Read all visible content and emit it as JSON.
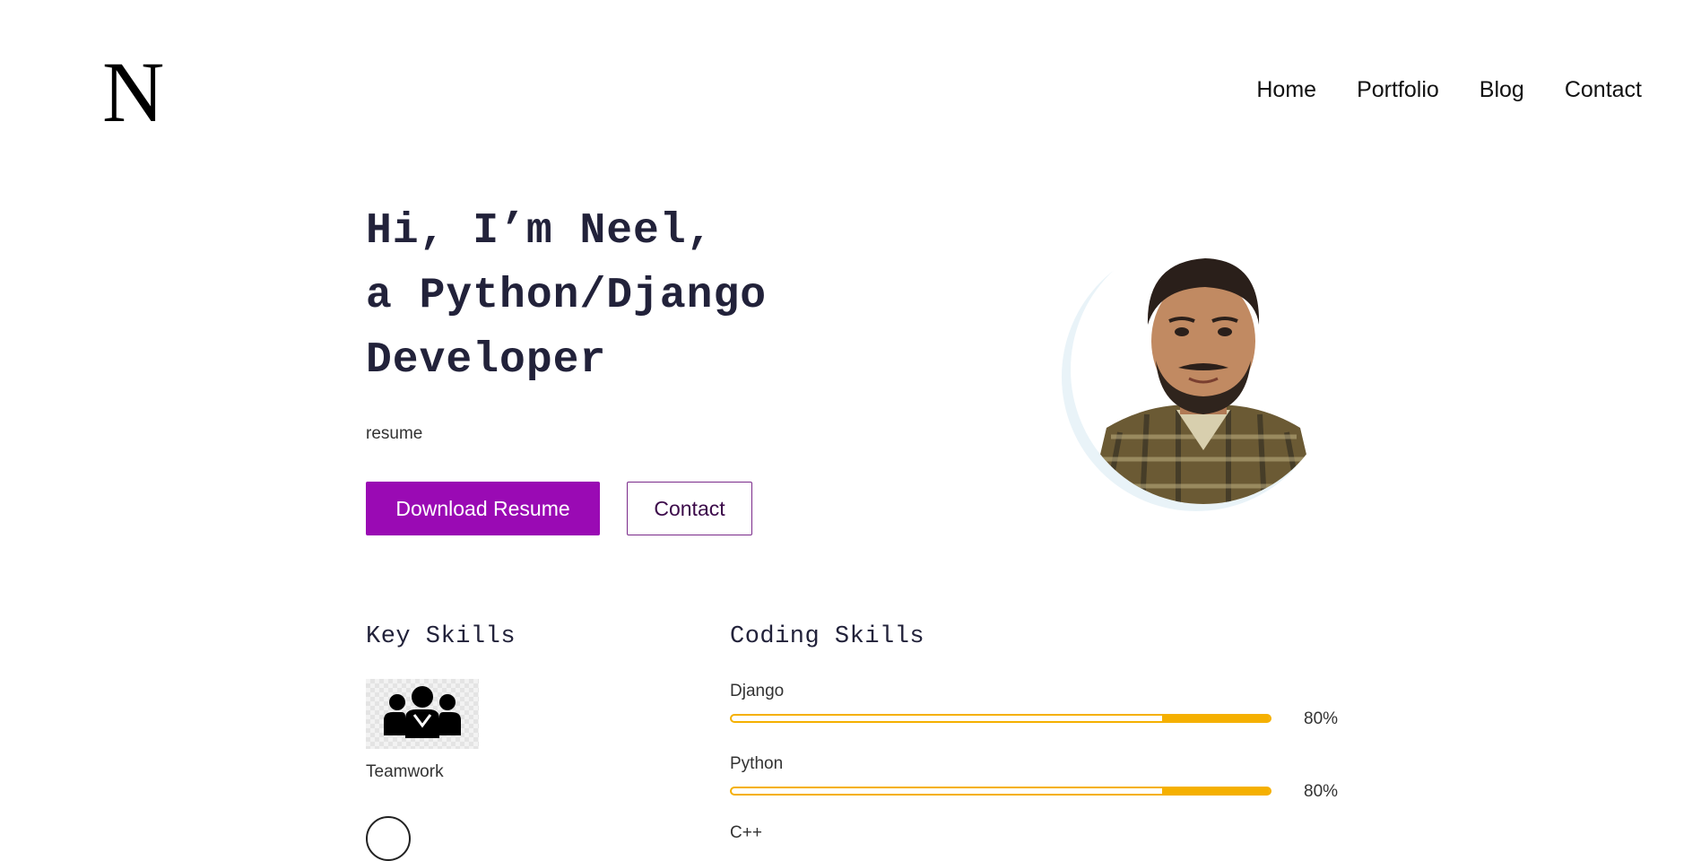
{
  "header": {
    "logo": "N",
    "nav": [
      "Home",
      "Portfolio",
      "Blog",
      "Contact"
    ]
  },
  "hero": {
    "line1": "Hi, I’m Neel,",
    "line2": "a Python/Django",
    "line3": "Developer",
    "resume_label": "resume",
    "download_button": "Download Resume",
    "contact_button": "Contact"
  },
  "key_skills": {
    "title": "Key Skills",
    "items": [
      {
        "name": "Teamwork",
        "icon": "teamwork-icon"
      }
    ]
  },
  "coding_skills": {
    "title": "Coding Skills",
    "items": [
      {
        "name": "Django",
        "percent": 80,
        "label": "80%"
      },
      {
        "name": "Python",
        "percent": 80,
        "label": "80%"
      }
    ],
    "partial_next_label": "C++"
  },
  "colors": {
    "primary": "#9a0ab4",
    "bar": "#f5b000",
    "heading": "#22223a"
  }
}
